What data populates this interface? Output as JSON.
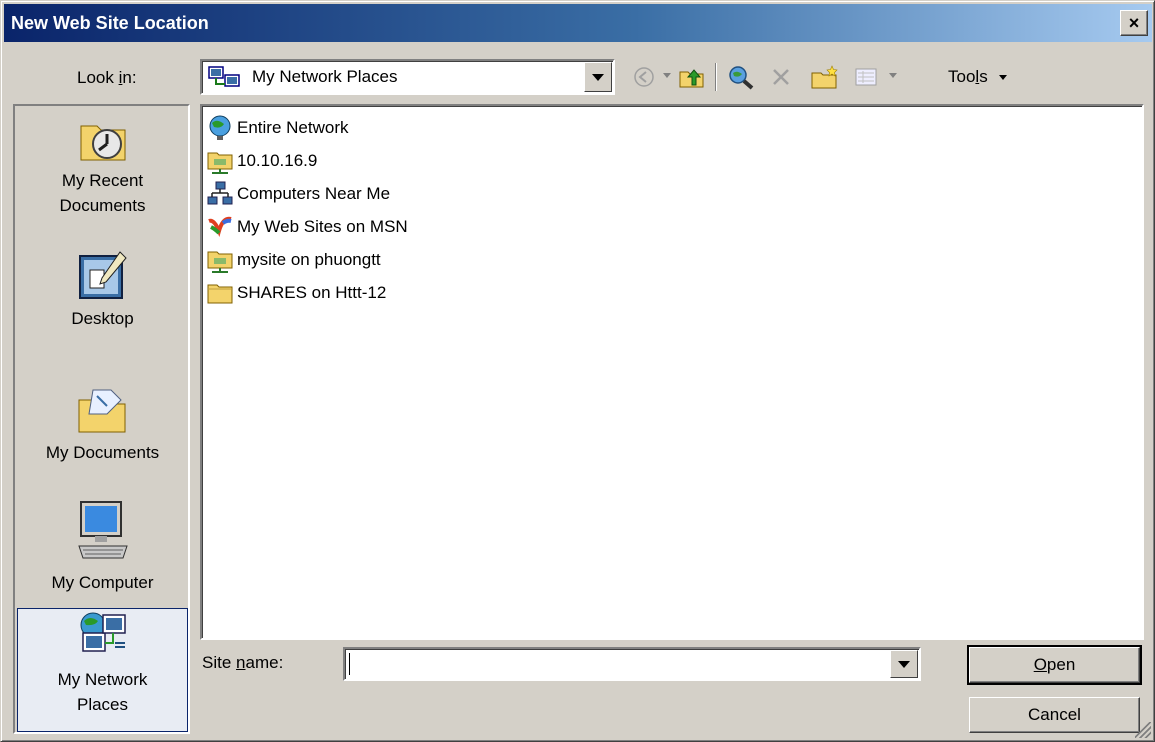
{
  "window": {
    "title": "New Web Site Location",
    "close_label": "×"
  },
  "lookin": {
    "label_pre": "Look ",
    "label_key": "i",
    "label_post": "n:",
    "value": "My Network Places",
    "icon": "network-places-icon"
  },
  "toolbar": {
    "back_icon": "back-icon",
    "up_icon": "up-folder-icon",
    "search_web_icon": "search-web-icon",
    "delete_icon": "delete-icon",
    "new_folder_icon": "new-folder-icon",
    "views_icon": "views-icon",
    "tools_pre": "Too",
    "tools_key": "l",
    "tools_post": "s"
  },
  "places": [
    {
      "label1": "My Recent",
      "label2": "Documents",
      "icon": "recent-documents-icon"
    },
    {
      "label1": "Desktop",
      "label2": "",
      "icon": "desktop-icon"
    },
    {
      "label1": "My Documents",
      "label2": "",
      "icon": "my-documents-icon"
    },
    {
      "label1": "My Computer",
      "label2": "",
      "icon": "my-computer-icon"
    },
    {
      "label1": "My Network",
      "label2": "Places",
      "icon": "network-places-icon",
      "selected": true
    }
  ],
  "files": [
    {
      "name": "Entire Network",
      "icon": "globe-icon"
    },
    {
      "name": "10.10.16.9",
      "icon": "network-folder-icon"
    },
    {
      "name": "Computers Near Me",
      "icon": "workgroup-icon"
    },
    {
      "name": "My Web Sites on MSN",
      "icon": "msn-icon"
    },
    {
      "name": "mysite on phuongtt",
      "icon": "network-folder-icon"
    },
    {
      "name": "SHARES on Httt-12",
      "icon": "folder-icon"
    }
  ],
  "sitename": {
    "label_pre": "Site ",
    "label_key": "n",
    "label_post": "ame:",
    "value": ""
  },
  "buttons": {
    "open_key": "O",
    "open_rest": "pen",
    "cancel": "Cancel"
  },
  "colors": {
    "title_gradient_start": "#0a246a",
    "title_gradient_end": "#a6caf0",
    "face": "#d4d0c8"
  }
}
